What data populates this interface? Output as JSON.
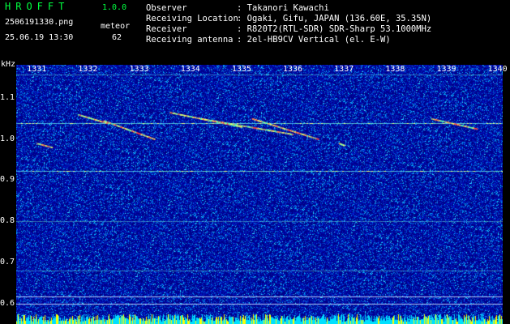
{
  "app": {
    "name": "HROFFT",
    "version": "1.0.0"
  },
  "file": "2506191330.png",
  "timestamp": "25.06.19 13:30",
  "meteor": {
    "label": "meteor",
    "count": "62"
  },
  "info": [
    {
      "key": "Observer",
      "value": ": Takanori Kawachi"
    },
    {
      "key": "Receiving Location",
      "value": ": Ogaki, Gifu, JAPAN (136.60E, 35.35N)"
    },
    {
      "key": "Receiver",
      "value": ": R820T2(RTL-SDR) SDR-Sharp 53.1000MHz"
    },
    {
      "key": "Receiving antenna",
      "value": ": 2el-HB9CV Vertical (el. E-W)"
    }
  ],
  "chart_data": {
    "type": "heatmap",
    "ylabel": "kHz",
    "x_ticks": [
      "1331",
      "1332",
      "1333",
      "1334",
      "1335",
      "1336",
      "1337",
      "1338",
      "1339",
      "1340"
    ],
    "y_ticks": [
      "1.1",
      "1.0",
      "0.9",
      "0.8",
      "0.7",
      "0.6"
    ],
    "ylim": [
      0.58,
      1.18
    ],
    "xlim": [
      1330.6,
      1340.1
    ],
    "carrier_lines_khz": [
      1.157,
      1.038,
      0.922,
      0.8,
      0.68,
      0.617,
      0.6
    ]
  }
}
